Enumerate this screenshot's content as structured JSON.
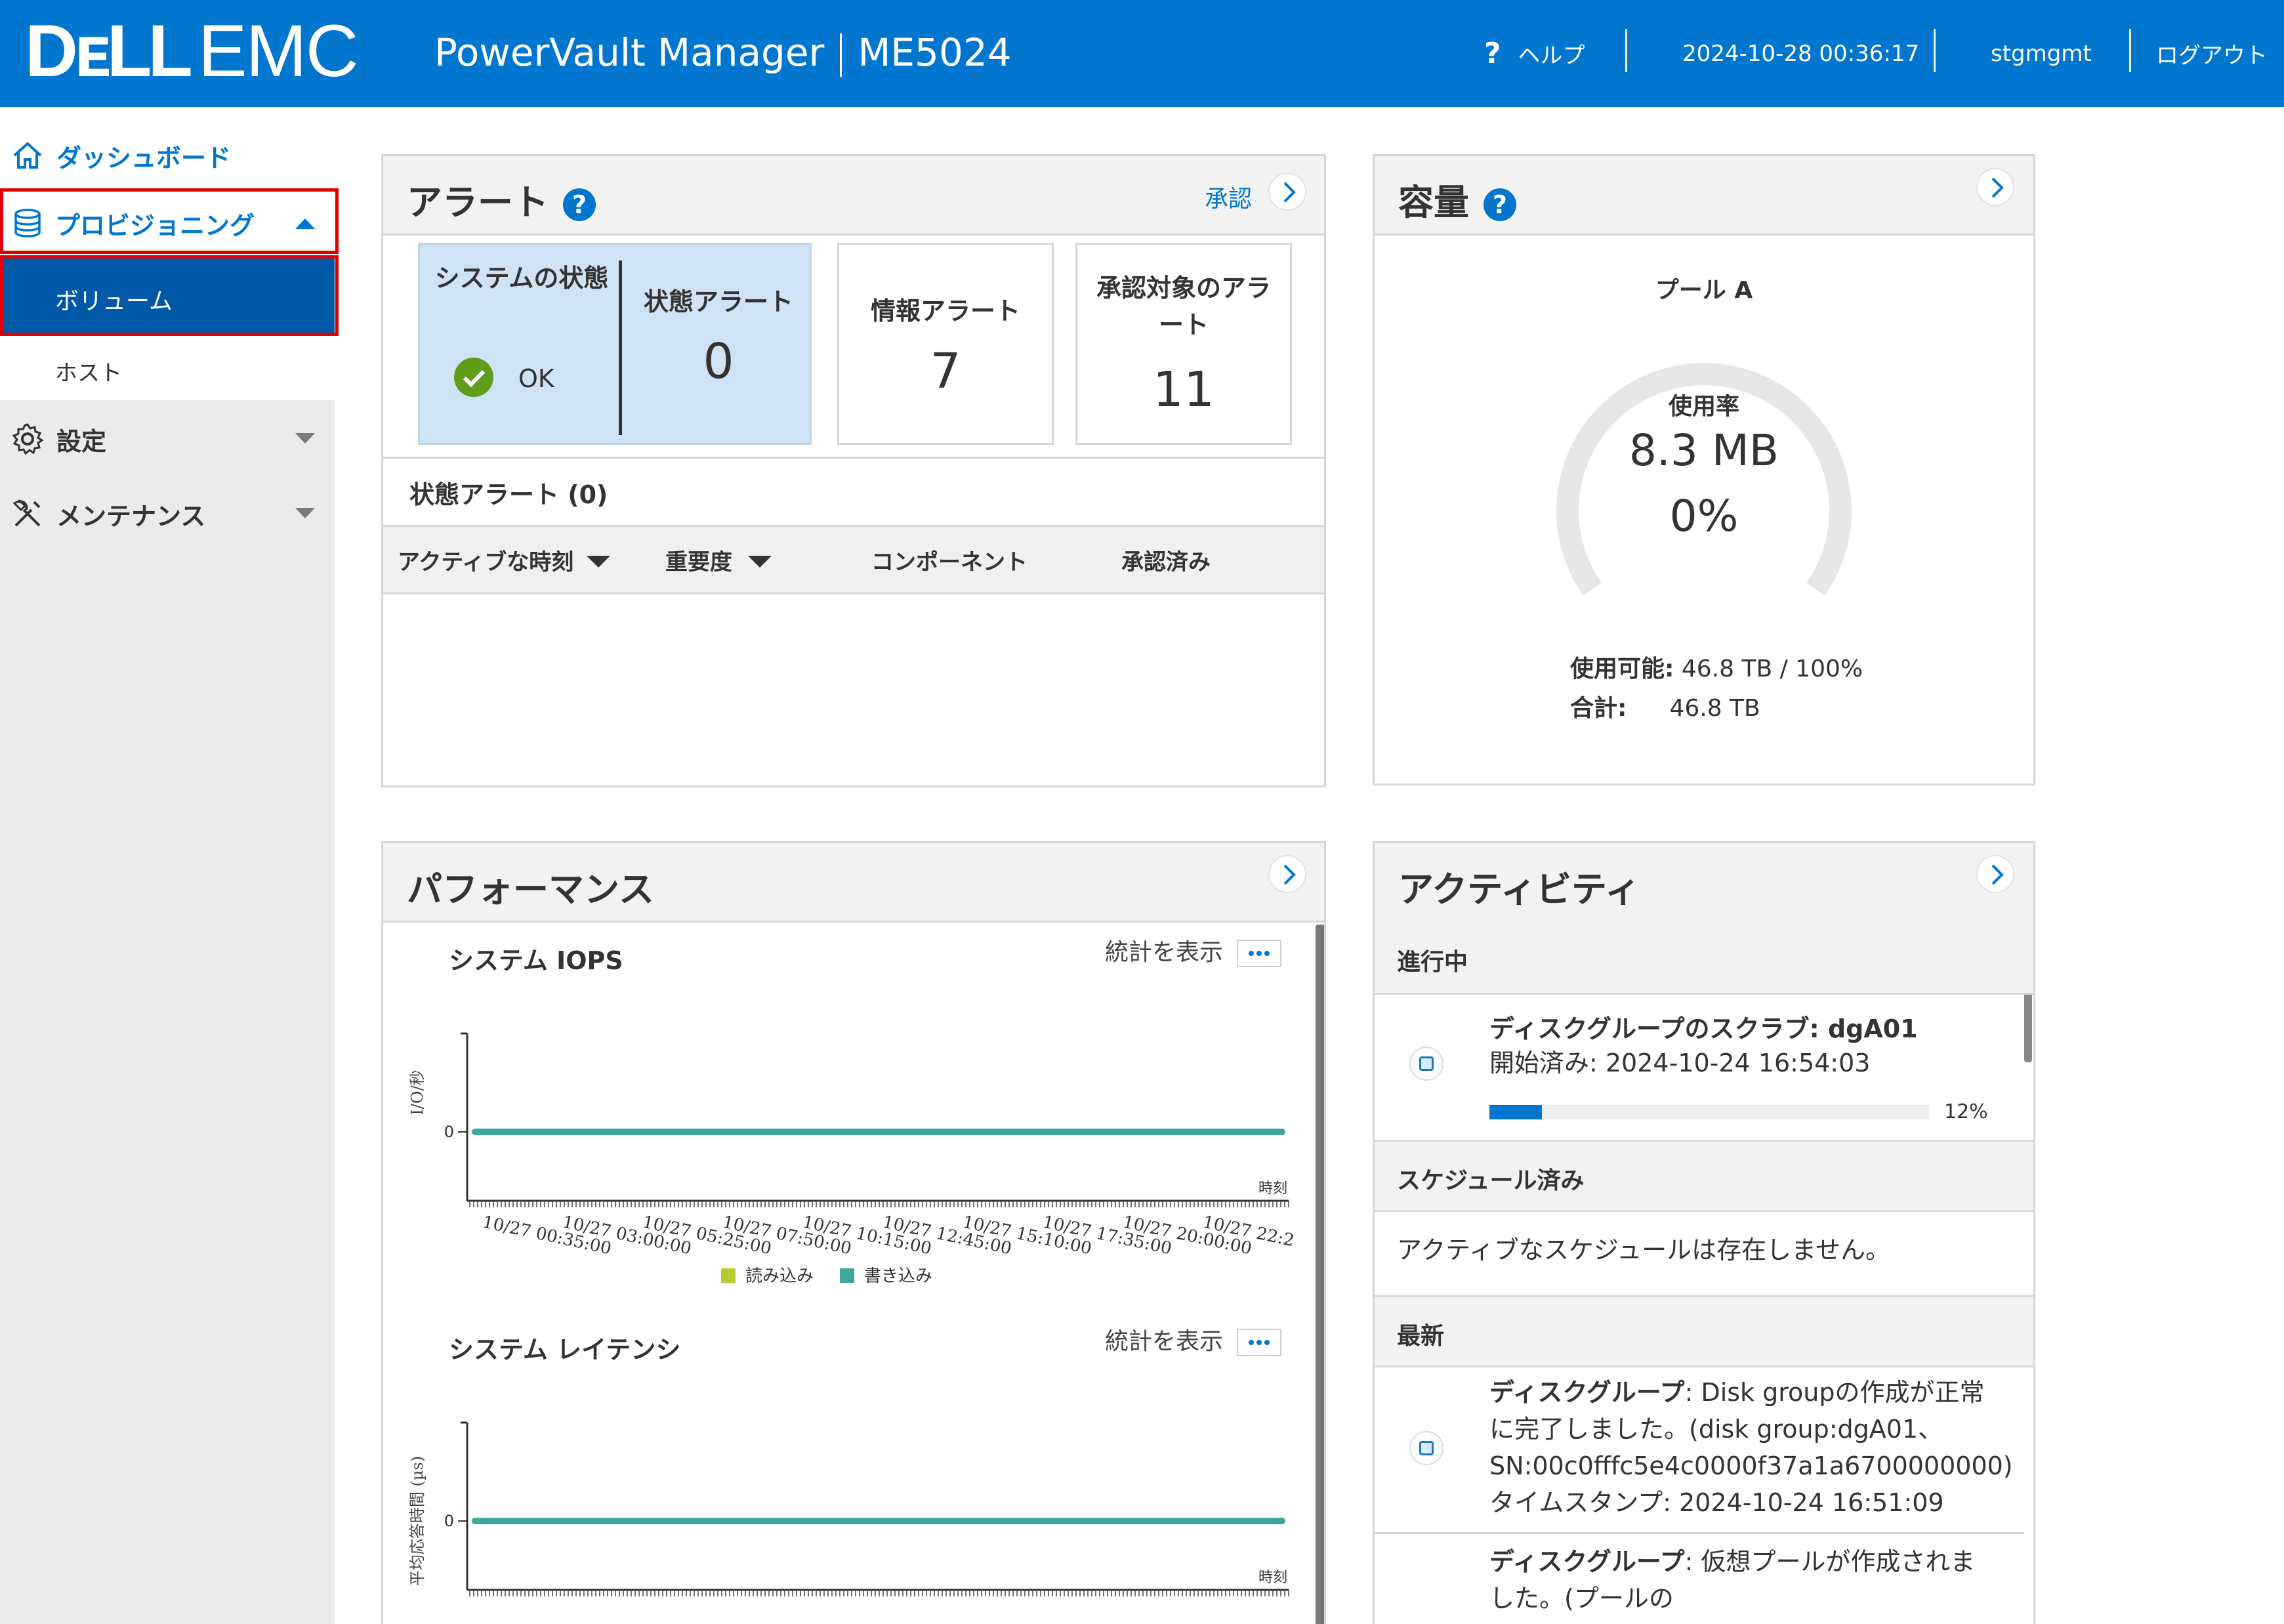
{
  "header": {
    "logo_text": "DELL EMC",
    "product": "PowerVault Manager",
    "model": "ME5024",
    "help_label": "ヘルプ",
    "datetime": "2024-10-28 00:36:17",
    "user": "stgmgmt",
    "logout_label": "ログアウト"
  },
  "sidebar": {
    "dashboard": "ダッシュボード",
    "provisioning": "プロビジョニング",
    "volumes": "ボリューム",
    "hosts": "ホスト",
    "settings": "設定",
    "maintenance": "メンテナンス"
  },
  "alerts": {
    "title": "アラート",
    "acknowledge": "承認",
    "system_health_label": "システムの状態",
    "system_health_value": "OK",
    "health_alerts_label": "状態アラート",
    "health_alerts_count": "0",
    "info_alerts_label": "情報アラート",
    "info_alerts_count": "7",
    "unack_alerts_label": "承認対象のアラート",
    "unack_alerts_count": "11",
    "list_title": "状態アラート (0)",
    "columns": [
      "アクティブな時刻",
      "重要度",
      "コンポーネント",
      "承認済み"
    ]
  },
  "capacity": {
    "title": "容量",
    "pool_name": "プール A",
    "usage_label": "使用率",
    "usage_amount": "8.3 MB",
    "usage_percent": "0%",
    "usage_fraction": 0.0,
    "available_label": "使用可能:",
    "available_value": "46.8 TB / 100%",
    "total_label": "合計:",
    "total_value": "46.8 TB"
  },
  "performance": {
    "title": "パフォーマンス",
    "iops_title": "システム IOPS",
    "latency_title": "システム レイテンシ",
    "show_stats": "統計を表示",
    "legend_read": "読み込み",
    "legend_write": "書き込み",
    "colors": {
      "read": "#b5cc2a",
      "write": "#3ea79b"
    },
    "chart_data": [
      {
        "type": "line",
        "title": "システム IOPS",
        "ylabel": "I/O/秒",
        "xlabel": "時刻",
        "y_ticks": [
          "0"
        ],
        "x_ticks": [
          "10/27 00:35:00",
          "10/27 03:00:00",
          "10/27 05:25:00",
          "10/27 07:50:00",
          "10/27 10:15:00",
          "10/27 12:45:00",
          "10/27 15:10:00",
          "10/27 17:35:00",
          "10/27 20:00:00",
          "10/27 22:2"
        ],
        "series": [
          {
            "name": "読み込み",
            "values": [
              0,
              0,
              0,
              0,
              0,
              0,
              0,
              0,
              0,
              0
            ]
          },
          {
            "name": "書き込み",
            "values": [
              0,
              0,
              0,
              0,
              0,
              0,
              0,
              0,
              0,
              0
            ]
          }
        ]
      },
      {
        "type": "line",
        "title": "システム レイテンシ",
        "ylabel": "平均応答時間 (µs)",
        "xlabel": "時刻",
        "y_ticks": [
          "0"
        ],
        "series": [
          {
            "name": "読み込み",
            "values": [
              0,
              0,
              0,
              0,
              0,
              0,
              0,
              0,
              0,
              0
            ]
          },
          {
            "name": "書き込み",
            "values": [
              0,
              0,
              0,
              0,
              0,
              0,
              0,
              0,
              0,
              0
            ]
          }
        ]
      }
    ]
  },
  "activity": {
    "title": "アクティビティ",
    "in_progress_label": "進行中",
    "job_title": "ディスクグループのスクラブ",
    "job_target": ": dgA01",
    "job_started": "開始済み: 2024-10-24 16:54:03",
    "job_progress": "12%",
    "job_progress_fraction": 0.12,
    "scheduled_label": "スケジュール済み",
    "no_schedules": "アクティブなスケジュールは存在しません。",
    "recent_label": "最新",
    "recent": [
      {
        "title": "ディスクグループ",
        "line1": ": Disk groupの作成が正常",
        "line2": "に完了しました。(disk group:dgA01、",
        "line3": "SN:00c0fffc5e4c0000f37a1a6700000000)",
        "line4": "タイムスタンプ: 2024-10-24 16:51:09"
      },
      {
        "title": "ディスクグループ",
        "line1": ": 仮想プールが作成されま",
        "line2": "した。(プールの"
      }
    ]
  }
}
